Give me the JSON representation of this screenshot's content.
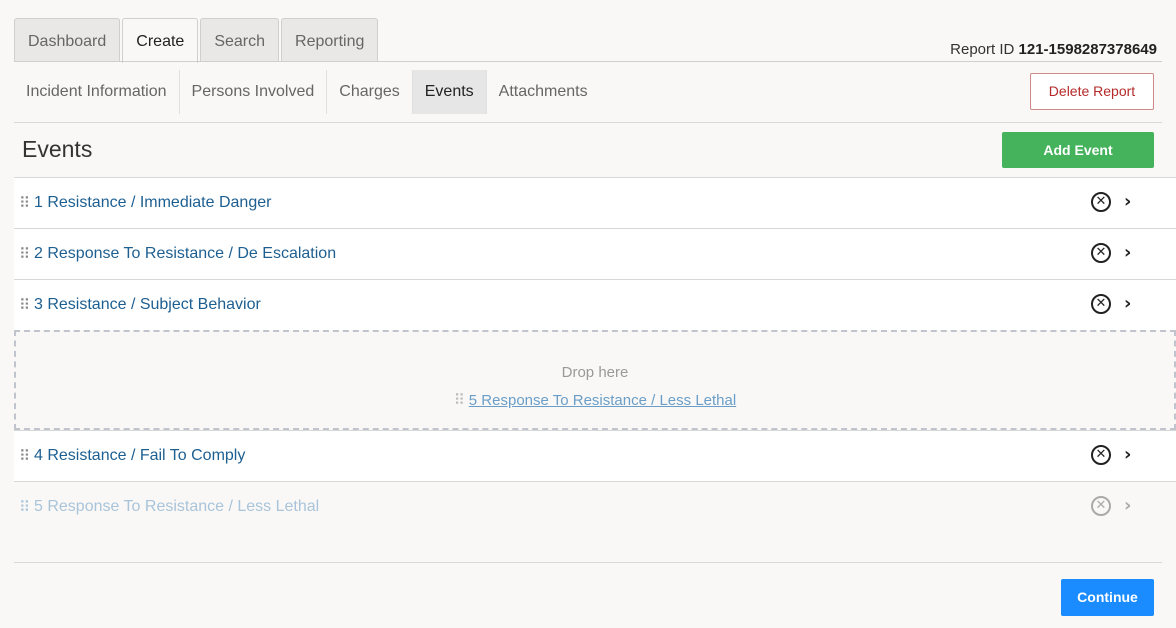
{
  "top_tabs": [
    "Dashboard",
    "Create",
    "Search",
    "Reporting"
  ],
  "active_top_tab": "Create",
  "report": {
    "label": "Report ID",
    "id": "121-1598287378649"
  },
  "sub_tabs": [
    "Incident Information",
    "Persons Involved",
    "Charges",
    "Events",
    "Attachments"
  ],
  "active_sub_tab": "Events",
  "delete_label": "Delete Report",
  "section_title": "Events",
  "add_event_label": "Add Event",
  "events": [
    {
      "label": "1 Resistance / Immediate Danger"
    },
    {
      "label": "2 Response To Resistance / De Escalation"
    },
    {
      "label": "3 Resistance / Subject Behavior"
    },
    {
      "label": "4 Resistance / Fail To Comply"
    },
    {
      "label": "5 Response To Resistance / Less Lethal"
    }
  ],
  "drop_zone": {
    "text": "Drop here",
    "dragged_label": "5 Response To Resistance / Less Lethal"
  },
  "icons": {
    "drag": "drag-handle-icon",
    "remove": "remove-circle-icon",
    "chevron": "chevron-right-icon"
  },
  "continue_label": "Continue",
  "colors": {
    "add": "#45b25c",
    "continue": "#1a8cff",
    "link": "#1e5f91",
    "delete": "#b52a2a"
  }
}
